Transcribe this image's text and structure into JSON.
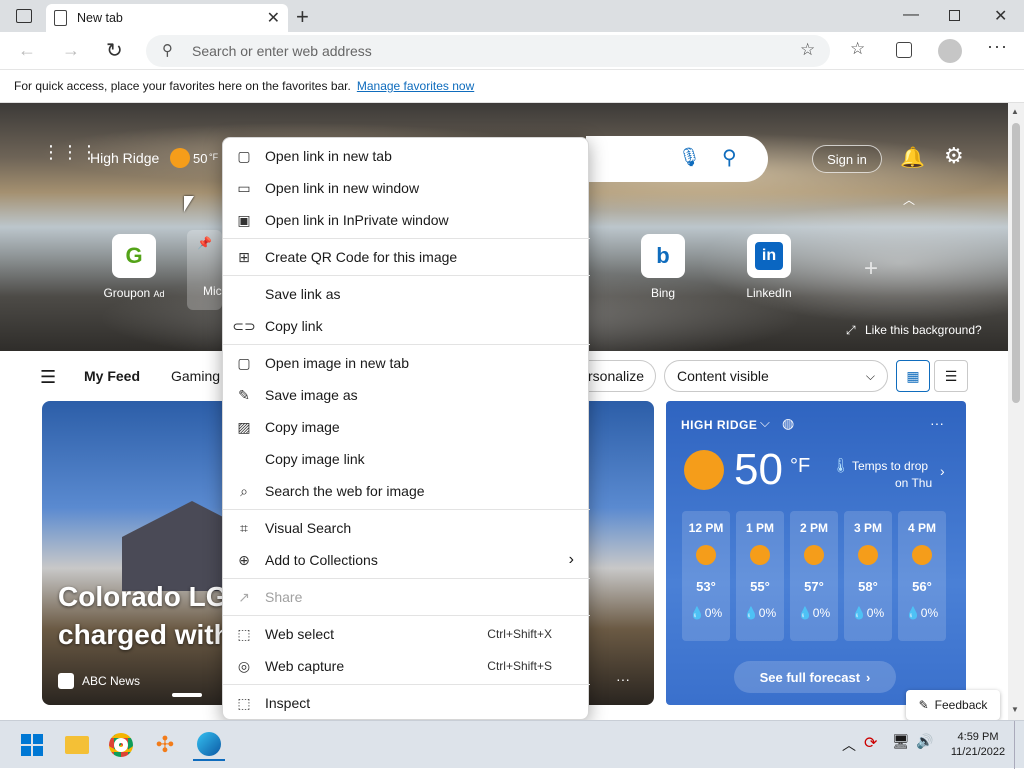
{
  "browser": {
    "tab_title": "New tab",
    "address_placeholder": "Search or enter web address",
    "favorites_text": "For quick access, place your favorites here on the favorites bar.",
    "favorites_link": "Manage favorites now"
  },
  "hero": {
    "location": "High Ridge",
    "temp": "50",
    "temp_unit": "°F",
    "sign_in": "Sign in",
    "like_background": "Like this background?",
    "quick_links": [
      {
        "label": "Groupon",
        "ad": "Ad",
        "glyph": "G"
      },
      {
        "label": "Mic",
        "glyph": ""
      },
      {
        "label": "Bing",
        "glyph": "b"
      },
      {
        "label": "LinkedIn",
        "glyph": "in"
      }
    ]
  },
  "feed": {
    "my_feed": "My Feed",
    "gaming": "Gaming",
    "personalize": "rsonalize",
    "content_visible": "Content visible",
    "headline": "Colorado LGB\ncharged with",
    "headline_line1": "Colorado LGE",
    "headline_line2": "charged with",
    "source": "ABC News"
  },
  "weather": {
    "location": "HIGH RIDGE",
    "temp": "50",
    "unit": "°F",
    "note_line1": "Temps to drop",
    "note_line2": "on Thu",
    "hours": [
      {
        "time": "12 PM",
        "temp": "53°",
        "precip": "0%"
      },
      {
        "time": "1 PM",
        "temp": "55°",
        "precip": "0%"
      },
      {
        "time": "2 PM",
        "temp": "57°",
        "precip": "0%"
      },
      {
        "time": "3 PM",
        "temp": "58°",
        "precip": "0%"
      },
      {
        "time": "4 PM",
        "temp": "56°",
        "precip": "0%"
      }
    ],
    "forecast_button": "See full forecast"
  },
  "context_menu": {
    "items": [
      {
        "label": "Open link in new tab",
        "icon": "new-tab-icon"
      },
      {
        "label": "Open link in new window",
        "icon": "window-icon"
      },
      {
        "label": "Open link in InPrivate window",
        "icon": "inprivate-icon"
      },
      {
        "label": "Create QR Code for this image",
        "icon": "qr-code-icon"
      },
      {
        "label": "Save link as",
        "icon": ""
      },
      {
        "label": "Copy link",
        "icon": "link-icon"
      },
      {
        "label": "Open image in new tab",
        "icon": "new-tab-icon"
      },
      {
        "label": "Save image as",
        "icon": "save-image-icon"
      },
      {
        "label": "Copy image",
        "icon": "image-icon"
      },
      {
        "label": "Copy image link",
        "icon": ""
      },
      {
        "label": "Search the web for image",
        "icon": "image-search-icon"
      },
      {
        "label": "Visual Search",
        "icon": "visual-search-icon"
      },
      {
        "label": "Add to Collections",
        "icon": "collections-icon"
      },
      {
        "label": "Share",
        "icon": "share-icon"
      },
      {
        "label": "Web select",
        "icon": "web-select-icon",
        "shortcut": "Ctrl+Shift+X"
      },
      {
        "label": "Web capture",
        "icon": "web-capture-icon",
        "shortcut": "Ctrl+Shift+S"
      },
      {
        "label": "Inspect",
        "icon": "inspect-icon"
      }
    ]
  },
  "feedback": "Feedback",
  "taskbar": {
    "time": "4:59 PM",
    "date": "11/21/2022"
  },
  "colors": {
    "accent": "#0f6cbd",
    "weather_bg": "#3a70cc",
    "sun": "#f59d1a"
  }
}
